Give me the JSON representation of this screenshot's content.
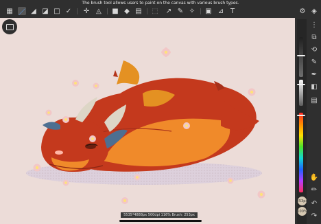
{
  "tooltip": "The brush tool allows users to paint on the canvas with various brush types.",
  "toolbar_icons": [
    "grid-icon",
    "brush-icon",
    "eraser-icon",
    "smudge-icon",
    "selection-icon",
    "transform-icon",
    "move-icon",
    "blur-icon",
    "sharpen-icon",
    "fill-color-icon",
    "paint-bucket-icon",
    "gradient-icon",
    "lasso-icon",
    "eyedropper-icon",
    "color-eyedropper-icon",
    "wand-icon",
    "crop-icon",
    "ruler-icon",
    "text-icon",
    "shapes-icon",
    "layers-icon"
  ],
  "brush_size_value": "253",
  "brush_size_unit": "px",
  "opacity_value": "100",
  "opacity_unit": "%",
  "status": "5535*4888px 500dpi 116% Brush: 253px 100%",
  "colors": {
    "accent": "#59a6ff",
    "dragon_red": "#c4391d",
    "dragon_orange": "#f08a2a",
    "background": "#ecdcd8"
  }
}
